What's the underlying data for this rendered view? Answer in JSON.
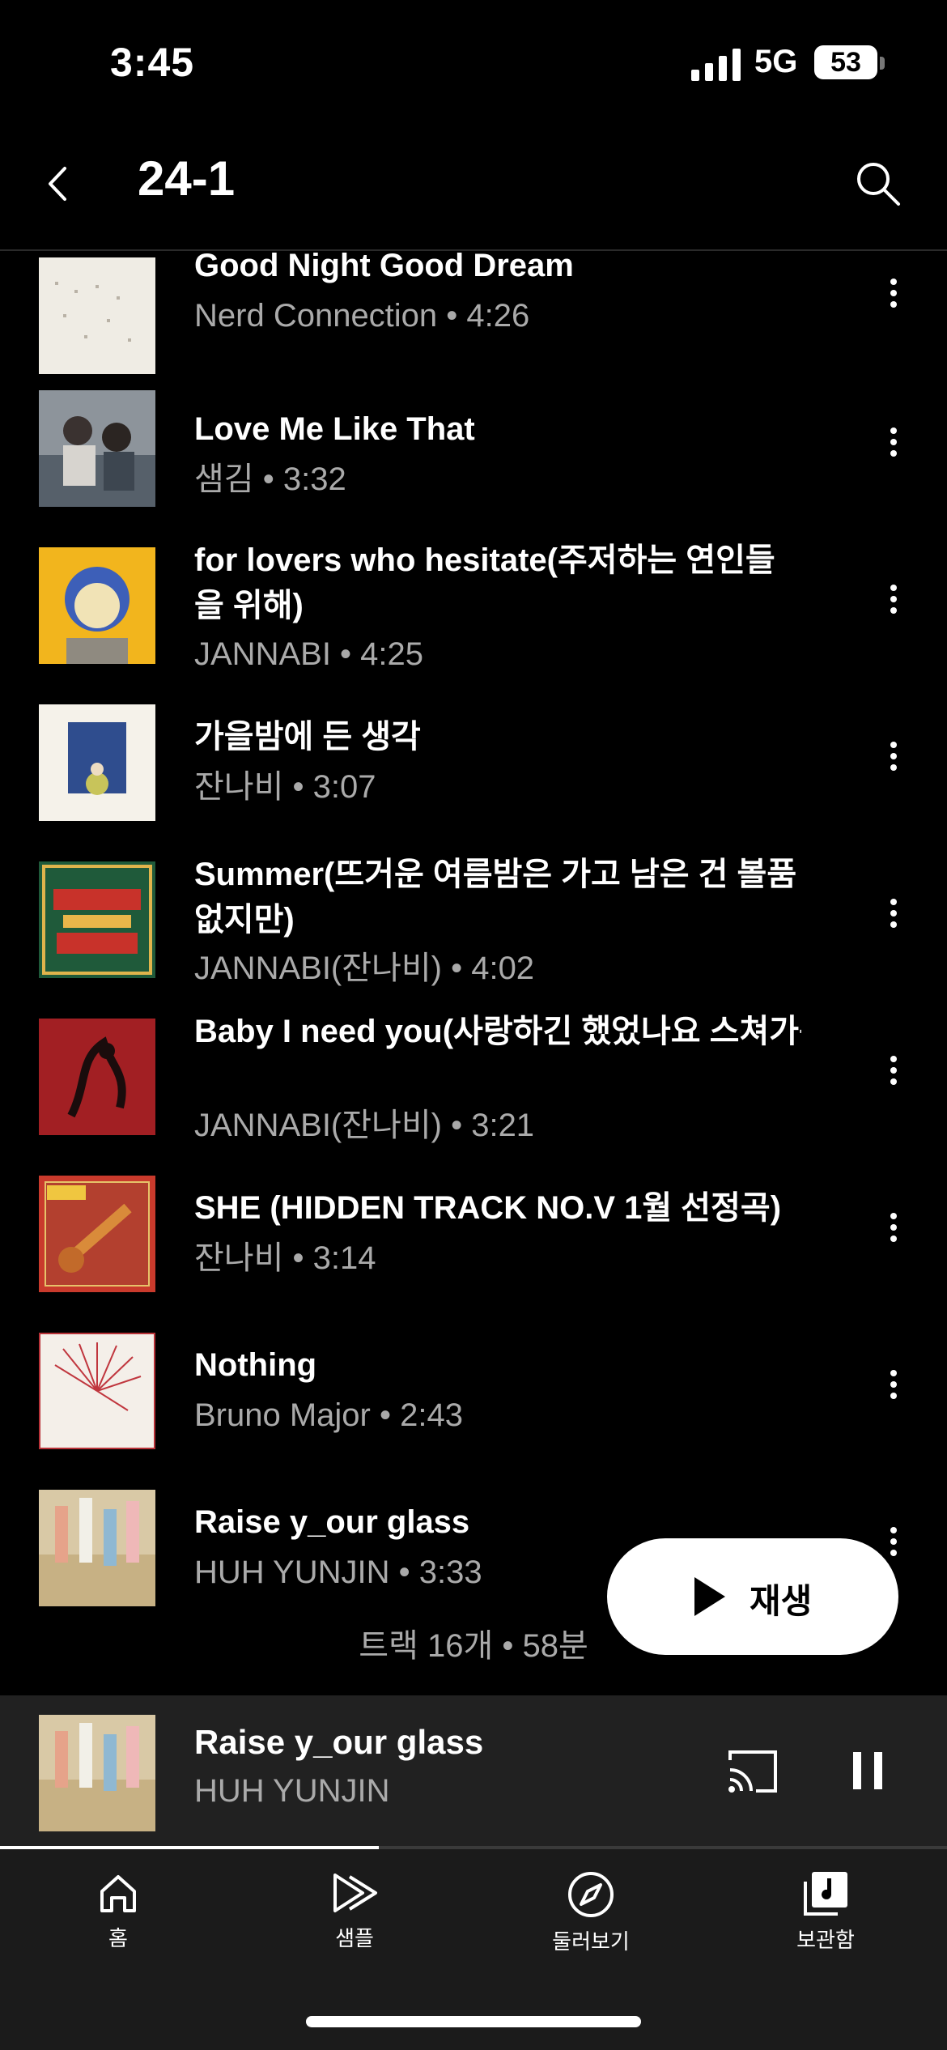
{
  "status_bar": {
    "time": "3:45",
    "network": "5G",
    "battery": "53"
  },
  "header": {
    "title": "24-1"
  },
  "tracks": [
    {
      "title": "Good Night Good Dream",
      "artist": "Nerd Connection",
      "duration": "4:26"
    },
    {
      "title": "Love Me Like That",
      "artist": "샘김",
      "duration": "3:32"
    },
    {
      "title": "for lovers who hesitate(주저하는 연인들을 위해)",
      "artist": "JANNABI",
      "duration": "4:25"
    },
    {
      "title": "가을밤에 든 생각",
      "artist": "잔나비",
      "duration": "3:07"
    },
    {
      "title": "Summer(뜨거운 여름밤은 가고 남은 건 볼품없지만)",
      "artist": "JANNABI(잔나비)",
      "duration": "4:02"
    },
    {
      "title": "Baby I need you(사랑하긴 했었나요 스쳐가는 인연이었나요 짧지않은 우리 함께…",
      "artist": "JANNABI(잔나비)",
      "duration": "3:21"
    },
    {
      "title": "SHE (HIDDEN TRACK NO.V 1월 선정곡)",
      "artist": "잔나비",
      "duration": "3:14"
    },
    {
      "title": "Nothing",
      "artist": "Bruno Major",
      "duration": "2:43"
    },
    {
      "title": "Raise y_our glass",
      "artist": "HUH YUNJIN",
      "duration": "3:33"
    }
  ],
  "summary": "트랙 16개 • 58분",
  "play_button": {
    "label": "재생"
  },
  "now_playing": {
    "title": "Raise y_our glass",
    "artist": "HUH YUNJIN",
    "progress": 0.4
  },
  "bottom_nav": [
    {
      "label": "홈",
      "icon": "home-icon"
    },
    {
      "label": "샘플",
      "icon": "samples-icon"
    },
    {
      "label": "둘러보기",
      "icon": "explore-icon"
    },
    {
      "label": "보관함",
      "icon": "library-icon"
    }
  ],
  "colors": {
    "background": "#000000",
    "secondary_text": "#aaaaaa",
    "mini_player": "#212121",
    "nav": "#1b1b1b"
  }
}
